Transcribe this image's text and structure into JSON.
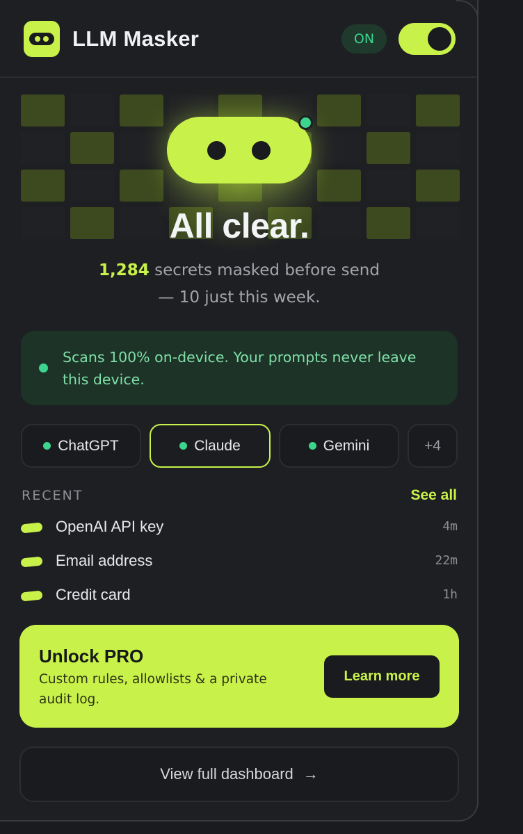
{
  "header": {
    "app_title": "LLM Masker",
    "status_label": "ON",
    "toggle_on": true
  },
  "hero": {
    "headline": "All clear.",
    "masked_count": "1,284",
    "masked_text": " secrets masked before send",
    "week_text": "— 10 just this week."
  },
  "privacy": {
    "message": "Scans 100% on-device. Your prompts never leave this device."
  },
  "platforms": {
    "tabs": [
      {
        "label": "ChatGPT",
        "active": false
      },
      {
        "label": "Claude",
        "active": true
      },
      {
        "label": "Gemini",
        "active": false
      }
    ],
    "more_label": "+4"
  },
  "recent": {
    "label": "RECENT",
    "see_all": "See all",
    "items": [
      {
        "name": "OpenAI API key",
        "time": "4m"
      },
      {
        "name": "Email address",
        "time": "22m"
      },
      {
        "name": "Credit card",
        "time": "1h"
      }
    ]
  },
  "promo": {
    "title": "Unlock PRO",
    "description": "Custom rules, allowlists & a private audit log.",
    "button": "Learn more"
  },
  "footer": {
    "dashboard_label": "View full dashboard",
    "arrow": "→"
  },
  "colors": {
    "accent": "#c8f24a",
    "success": "#3bd58e",
    "background": "#1e1f22"
  },
  "icons": {
    "logo": "mask-icon",
    "status": "status-dot-icon"
  }
}
